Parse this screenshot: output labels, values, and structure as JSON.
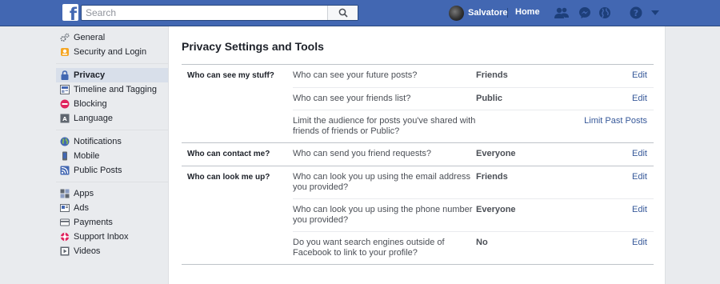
{
  "search": {
    "placeholder": "Search"
  },
  "header": {
    "profile_name": "Salvatore",
    "home_label": "Home"
  },
  "nav": {
    "groups": [
      [
        {
          "label": "General",
          "icon": "gear-icon"
        },
        {
          "label": "Security and Login",
          "icon": "badge-icon"
        }
      ],
      [
        {
          "label": "Privacy",
          "icon": "padlock-icon",
          "active": true
        },
        {
          "label": "Timeline and Tagging",
          "icon": "timeline-icon"
        },
        {
          "label": "Blocking",
          "icon": "block-icon"
        },
        {
          "label": "Language",
          "icon": "language-icon"
        }
      ],
      [
        {
          "label": "Notifications",
          "icon": "globe-icon"
        },
        {
          "label": "Mobile",
          "icon": "mobile-icon"
        },
        {
          "label": "Public Posts",
          "icon": "rss-icon"
        }
      ],
      [
        {
          "label": "Apps",
          "icon": "apps-icon"
        },
        {
          "label": "Ads",
          "icon": "ads-icon"
        },
        {
          "label": "Payments",
          "icon": "payments-icon"
        },
        {
          "label": "Support Inbox",
          "icon": "lifebuoy-icon"
        },
        {
          "label": "Videos",
          "icon": "video-icon"
        }
      ]
    ]
  },
  "page": {
    "title": "Privacy Settings and Tools"
  },
  "sections": [
    {
      "label": "Who can see my stuff?",
      "rows": [
        {
          "question": "Who can see your future posts?",
          "value": "Friends",
          "action": "Edit"
        },
        {
          "question": "Who can see your friends list?",
          "value": "Public",
          "action": "Edit"
        },
        {
          "question": "Limit the audience for posts you've shared with friends of friends or Public?",
          "value": "",
          "action": "Limit Past Posts"
        }
      ]
    },
    {
      "label": "Who can contact me?",
      "rows": [
        {
          "question": "Who can send you friend requests?",
          "value": "Everyone",
          "action": "Edit"
        }
      ]
    },
    {
      "label": "Who can look me up?",
      "rows": [
        {
          "question": "Who can look you up using the email address you provided?",
          "value": "Friends",
          "action": "Edit"
        },
        {
          "question": "Who can look you up using the phone number you provided?",
          "value": "Everyone",
          "action": "Edit"
        },
        {
          "question": "Do you want search engines outside of Facebook to link to your profile?",
          "value": "No",
          "action": "Edit"
        }
      ]
    }
  ],
  "colors": {
    "topbar": "#4267b2",
    "link": "#365899",
    "active_nav": "#d8dfea",
    "page_bg": "#e9ebee"
  }
}
